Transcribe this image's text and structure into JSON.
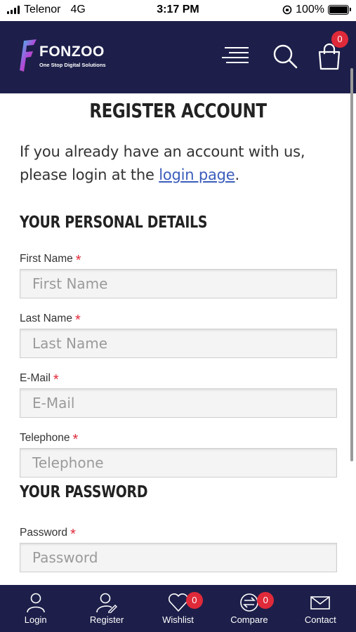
{
  "status_bar": {
    "carrier": "Telenor",
    "network": "4G",
    "time": "3:17 PM",
    "battery": "100%"
  },
  "header": {
    "brand": "FONZOO",
    "tagline": "One Stop Digital Solutions",
    "cart_count": "0",
    "accent": "#e02a3a",
    "background": "#1d1f4a"
  },
  "page": {
    "title": "REGISTER ACCOUNT",
    "intro_text": "If you already have an account with us, please login at the",
    "login_link": "login page",
    "intro_end": "."
  },
  "personal": {
    "heading": "YOUR PERSONAL DETAILS",
    "fields": [
      {
        "label": "First Name",
        "placeholder": "First Name",
        "required": "*"
      },
      {
        "label": "Last Name",
        "placeholder": "Last Name",
        "required": "*"
      },
      {
        "label": "E-Mail",
        "placeholder": "E-Mail",
        "required": "*"
      },
      {
        "label": "Telephone",
        "placeholder": "Telephone",
        "required": "*"
      }
    ]
  },
  "password": {
    "heading": "YOUR PASSWORD",
    "fields": [
      {
        "label": "Password",
        "placeholder": "Password",
        "required": "*"
      }
    ]
  },
  "bottom_nav": {
    "items": [
      {
        "label": "Login",
        "icon": "user-icon"
      },
      {
        "label": "Register",
        "icon": "user-edit-icon"
      },
      {
        "label": "Wishlist",
        "icon": "heart-icon",
        "badge": "0"
      },
      {
        "label": "Compare",
        "icon": "compare-icon",
        "badge": "0"
      },
      {
        "label": "Contact",
        "icon": "envelope-icon"
      }
    ]
  }
}
